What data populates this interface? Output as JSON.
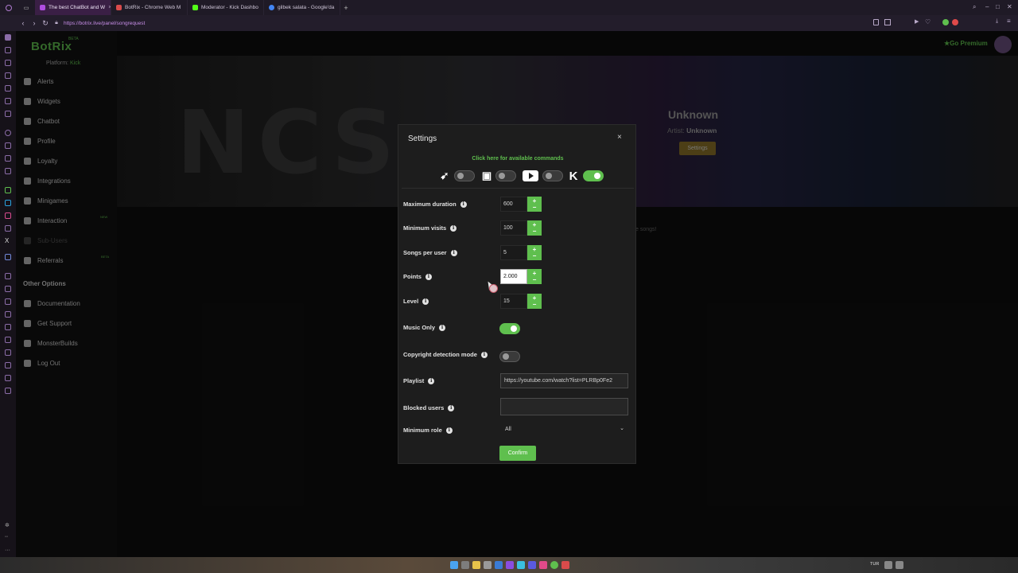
{
  "browser": {
    "tabs": [
      {
        "title": "The best ChatBot and W",
        "active": true,
        "color": "#b04de0"
      },
      {
        "title": "BotRix - Chrome Web M",
        "active": false,
        "color": "#d94b4b"
      },
      {
        "title": "Moderator - Kick Dashbo",
        "active": false,
        "color": "#53fc18"
      },
      {
        "title": "gilbek salata - Google'da",
        "active": false,
        "color": "#4285f4"
      }
    ],
    "url": "https://botrix.live/panel/songrequest",
    "new_tab": "+"
  },
  "app": {
    "logo": "BotRix",
    "beta": "BETA",
    "platform_label": "Platform:",
    "platform_value": "Kick",
    "premium": "Go Premium",
    "accent_color": "#5fbf4e"
  },
  "sidebar": {
    "items": [
      {
        "label": "Alerts",
        "icon": "alert-icon"
      },
      {
        "label": "Widgets",
        "icon": "widget-icon"
      },
      {
        "label": "Chatbot",
        "icon": "chat-icon"
      },
      {
        "label": "Profile",
        "icon": "user-icon"
      },
      {
        "label": "Loyalty",
        "icon": "heart-icon"
      },
      {
        "label": "Integrations",
        "icon": "link-icon"
      },
      {
        "label": "Minigames",
        "icon": "gamepad-icon"
      },
      {
        "label": "Interaction",
        "icon": "music-icon",
        "badge": "NEW"
      },
      {
        "label": "Sub-Users",
        "icon": "users-icon",
        "dim": true
      },
      {
        "label": "Referrals",
        "icon": "referral-icon",
        "badge": "BETA"
      }
    ],
    "other_header": "Other Options",
    "other_items": [
      {
        "label": "Documentation",
        "icon": "book-icon"
      },
      {
        "label": "Get Support",
        "icon": "support-icon"
      },
      {
        "label": "MonsterBuilds",
        "icon": "wrench-icon"
      },
      {
        "label": "Log Out",
        "icon": "logout-icon"
      }
    ]
  },
  "now_playing": {
    "banner_text": "NCS",
    "title": "Unknown",
    "artist_label": "Artist:",
    "artist": "Unknown",
    "settings_button": "Settings",
    "songs_text": "e songs!"
  },
  "modal": {
    "title": "Settings",
    "close": "×",
    "commands_link": "Click here for available commands",
    "platforms": [
      {
        "name": "botrix",
        "icon": "botrix-icon",
        "enabled": false
      },
      {
        "name": "twitch",
        "icon": "twitch-icon",
        "enabled": false
      },
      {
        "name": "youtube",
        "icon": "youtube-icon",
        "enabled": false
      },
      {
        "name": "kick",
        "icon": "kick-icon",
        "enabled": true
      }
    ],
    "fields": {
      "max_duration": {
        "label": "Maximum duration",
        "value": "600"
      },
      "min_visits": {
        "label": "Minimum visits",
        "value": "100"
      },
      "songs_per_user": {
        "label": "Songs per user",
        "value": "5"
      },
      "points": {
        "label": "Points",
        "value": "2.000"
      },
      "level": {
        "label": "Level",
        "value": "15"
      },
      "music_only": {
        "label": "Music Only",
        "enabled": true
      },
      "copyright": {
        "label": "Copyright detection mode",
        "enabled": false
      },
      "playlist": {
        "label": "Playlist",
        "value": "https://youtube.com/watch?list=PLRBp0Fe2"
      },
      "blocked_users": {
        "label": "Blocked users",
        "value": ""
      },
      "min_role": {
        "label": "Minimum role",
        "value": "All"
      }
    },
    "plus": "+",
    "minus": "−",
    "info": "i",
    "confirm": "Confirm"
  },
  "taskbar": {
    "lang": "TUR"
  }
}
